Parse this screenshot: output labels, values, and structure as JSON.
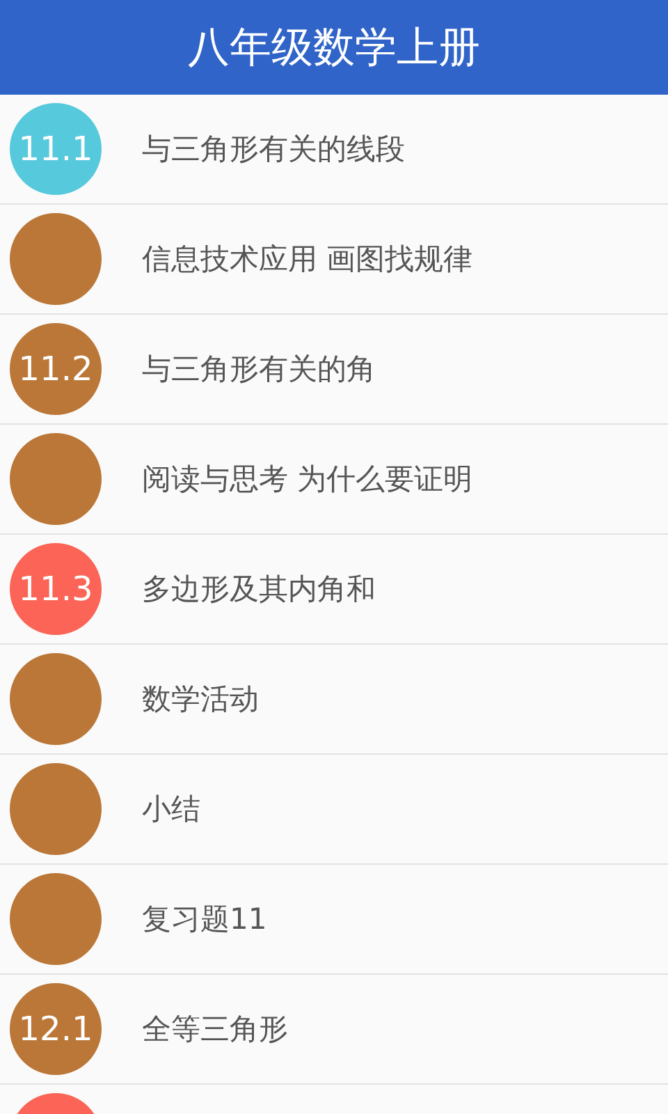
{
  "header": {
    "title": "八年级数学上册"
  },
  "items": [
    {
      "number": "11.1",
      "label": "与三角形有关的线段",
      "color": "#56c9dc"
    },
    {
      "label": "信息技术应用 画图找规律",
      "color": "#bb7737"
    },
    {
      "number": "11.2",
      "label": "与三角形有关的角",
      "color": "#bb7737"
    },
    {
      "label": "阅读与思考 为什么要证明",
      "color": "#bb7737"
    },
    {
      "number": "11.3",
      "label": "多边形及其内角和",
      "color": "#fb6456"
    },
    {
      "label": "数学活动",
      "color": "#bb7737"
    },
    {
      "label": "小结",
      "color": "#bb7737"
    },
    {
      "label": "复习题11",
      "color": "#bb7737"
    },
    {
      "number": "12.1",
      "label": "全等三角形",
      "color": "#bb7737"
    },
    {
      "color": "#fb6456"
    }
  ]
}
